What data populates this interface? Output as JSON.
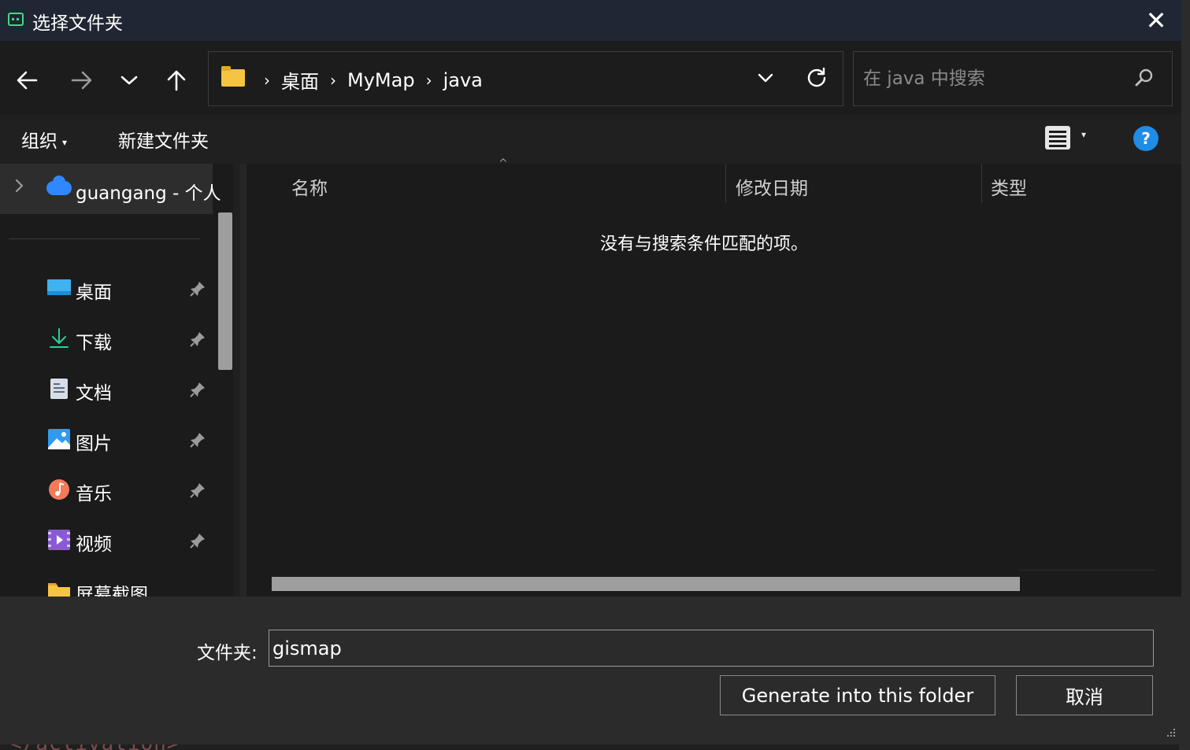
{
  "window": {
    "title": "选择文件夹",
    "close_label": "✕"
  },
  "nav": {
    "back_icon": "←",
    "forward_icon": "→",
    "recent_icon": "⌄",
    "up_icon": "↑",
    "breadcrumbs": [
      "桌面",
      "MyMap",
      "java"
    ],
    "crumb_separator": "›",
    "dropdown_icon": "⌄",
    "refresh_icon": "↻"
  },
  "search": {
    "placeholder": "在 java 中搜索"
  },
  "toolbar": {
    "organize_label": "组织",
    "organize_caret": "▾",
    "new_folder_label": "新建文件夹",
    "view_caret": "▾",
    "help_label": "?"
  },
  "sidebar": {
    "onedrive_label": "guangang - 个人",
    "items": [
      {
        "label": "桌面",
        "icon": "desktop-icon"
      },
      {
        "label": "下载",
        "icon": "download-icon"
      },
      {
        "label": "文档",
        "icon": "documents-icon"
      },
      {
        "label": "图片",
        "icon": "pictures-icon"
      },
      {
        "label": "音乐",
        "icon": "music-icon"
      },
      {
        "label": "视频",
        "icon": "videos-icon"
      },
      {
        "label": "屏幕截图",
        "icon": "folder-icon"
      }
    ]
  },
  "filelist": {
    "columns": [
      "名称",
      "修改日期",
      "类型"
    ],
    "sort_indicator": "^",
    "empty_message": "没有与搜索条件匹配的项。"
  },
  "footer": {
    "folder_label": "文件夹:",
    "folder_value": "gismap",
    "generate_label": "Generate into this folder",
    "cancel_label": "取消"
  },
  "background": {
    "code_fragment": "</activation>"
  },
  "colors": {
    "accent": "#1f8ce6",
    "titlebar": "#202634",
    "app_icon": "#3ddc84"
  }
}
